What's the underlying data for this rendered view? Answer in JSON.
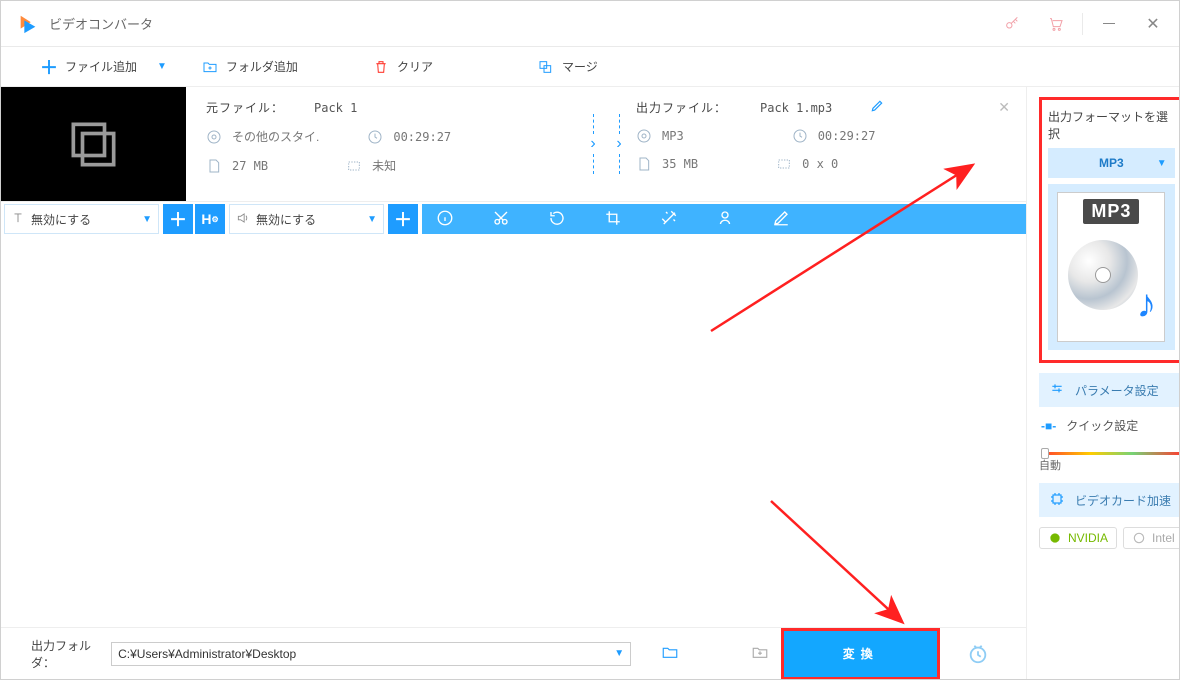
{
  "window": {
    "title": "ビデオコンバータ"
  },
  "toolbar": {
    "add_file": "ファイル追加",
    "add_folder": "フォルダ追加",
    "clear": "クリア",
    "merge": "マージ"
  },
  "item": {
    "source_label": "元ファイル：",
    "source_name": "Pack 1",
    "output_label": "出力ファイル：",
    "output_name": "Pack 1.mp3",
    "style": "その他のスタイ.",
    "src_duration": "00:29:27",
    "src_size": "27 MB",
    "src_resolution": "未知",
    "format": "MP3",
    "out_duration": "00:29:27",
    "out_size": "35 MB",
    "out_resolution": "0 x 0"
  },
  "strips": {
    "subtitle_select": "無効にする",
    "audio_select": "無効にする"
  },
  "bottom": {
    "output_folder_label": "出力フォルダ：",
    "path": "C:¥Users¥Administrator¥Desktop",
    "convert": "変換"
  },
  "sidebar": {
    "heading": "出力フォーマットを選択",
    "format_selected": "MP3",
    "format_badge": "MP3",
    "parameter_settings": "パラメータ設定",
    "quick_settings": "クイック設定",
    "slider_label": "自動",
    "gpu_accel": "ビデオカード加速",
    "chips": {
      "nvidia": "NVIDIA",
      "intel": "Intel"
    }
  }
}
